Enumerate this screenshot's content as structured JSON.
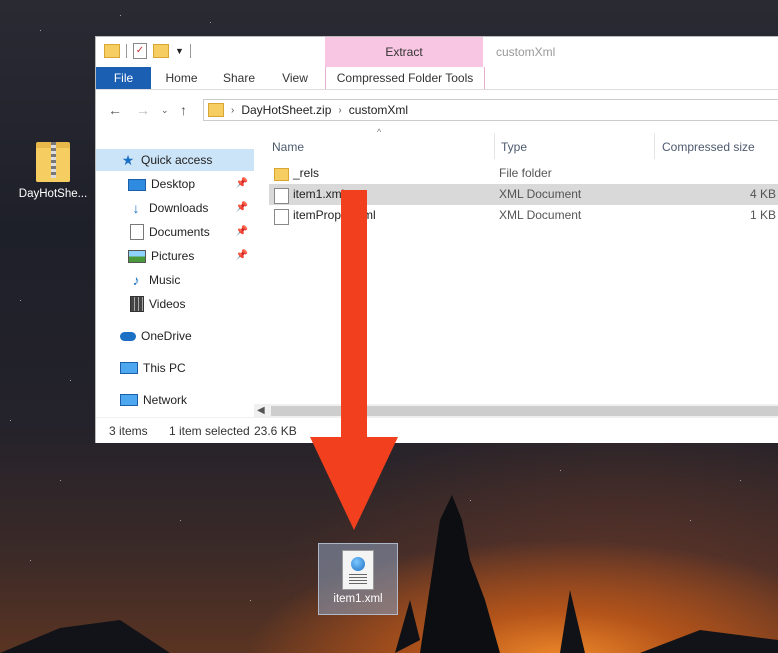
{
  "desktop": {
    "zip_icon_label": "DayHotShe...",
    "xml_icon_label": "item1.xml"
  },
  "window": {
    "title": "customXml",
    "context_tab_group": "Extract",
    "ribbon_tabs": [
      "File",
      "Home",
      "Share",
      "View",
      "Compressed Folder Tools"
    ]
  },
  "address": {
    "segments": [
      "DayHotSheet.zip",
      "customXml"
    ]
  },
  "nav_pane": {
    "quick_access": "Quick access",
    "items": [
      "Desktop",
      "Downloads",
      "Documents",
      "Pictures",
      "Music",
      "Videos"
    ],
    "onedrive": "OneDrive",
    "this_pc": "This PC",
    "network": "Network"
  },
  "columns": {
    "name": "Name",
    "type": "Type",
    "size": "Compressed size"
  },
  "files": [
    {
      "name": "_rels",
      "type": "File folder",
      "size": "",
      "icon": "folder-icon",
      "selected": false
    },
    {
      "name": "item1.xml",
      "type": "XML Document",
      "size": "4 KB",
      "icon": "xml-file-icon",
      "selected": true
    },
    {
      "name": "itemProps1.xml",
      "type": "XML Document",
      "size": "1 KB",
      "icon": "xml-file-icon",
      "selected": false
    }
  ],
  "status": {
    "count": "3 items",
    "selection": "1 item selected",
    "size": "23.6 KB"
  },
  "colors": {
    "accent": "#1b5fb3",
    "context_tab": "#f8c6e3",
    "arrow": "#f2401e"
  }
}
